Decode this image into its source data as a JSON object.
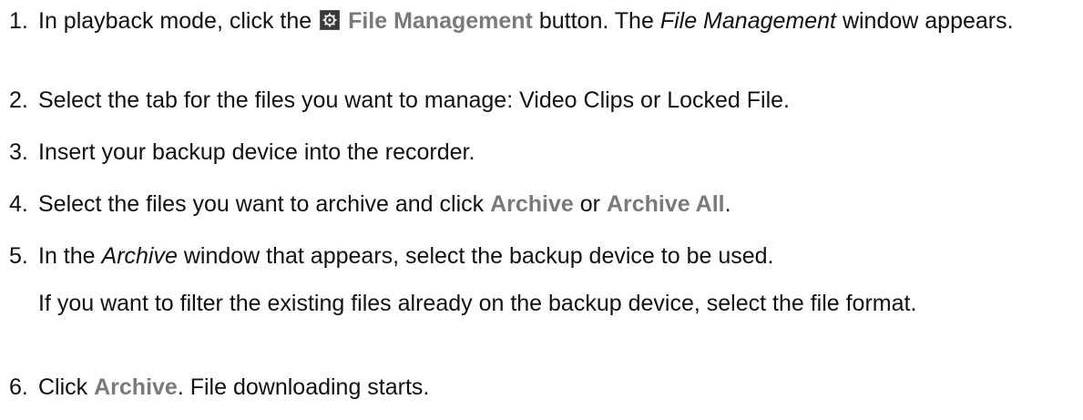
{
  "steps": [
    {
      "num": "1.",
      "a": "In playback mode, click the",
      "icon": "gear-icon",
      "ui": "File Management",
      "b": "button. The",
      "ital": "File Management",
      "c": "window appears."
    },
    {
      "num": "2.",
      "text": "Select the tab for the files you want to manage: Video Clips or Locked File."
    },
    {
      "num": "3.",
      "text": "Insert your backup device into the recorder."
    },
    {
      "num": "4.",
      "a": "Select the files you want to archive and click",
      "ui1": "Archive",
      "b": "or",
      "ui2": "Archive All",
      "c": "."
    },
    {
      "num": "5.",
      "a": "In the",
      "ital": "Archive",
      "b": "window that appears, select the backup device to be used.",
      "note": "If you want to filter the existing files already on the backup device, select the file format."
    },
    {
      "num": "6.",
      "a": "Click",
      "ui": "Archive",
      "b": ". File downloading starts."
    }
  ]
}
